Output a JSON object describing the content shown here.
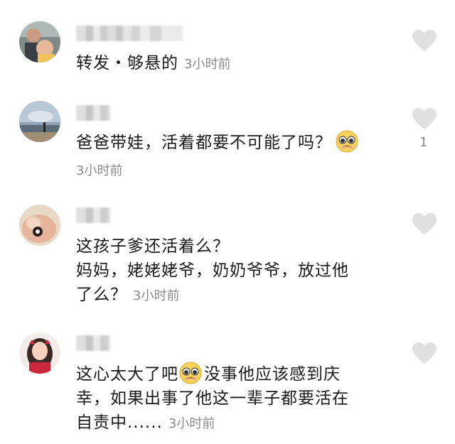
{
  "comments": [
    {
      "text_parts": [
        "转发・够悬的"
      ],
      "time": "3小时前",
      "like_count": ""
    },
    {
      "text_parts": [
        "爸爸带娃，活着都要不可能了吗？"
      ],
      "time": "3小时前",
      "like_count": "1"
    },
    {
      "lines": [
        "这孩子爹还活着么？",
        "妈妈，姥姥姥爷，奶奶爷爷，放过他",
        "了么？"
      ],
      "time": "3小时前",
      "like_count": ""
    },
    {
      "lines_a": "这心太大了吧",
      "lines_b": "没事他应该感到庆",
      "line2": "幸，如果出事了他这一辈子都要活在",
      "line3": "自责中......",
      "time": "3小时前",
      "like_count": ""
    }
  ],
  "icons": {
    "heart": "heart-icon",
    "emoji": "pleading-face-emoji"
  },
  "colors": {
    "heart": "#e0e0e0",
    "time": "#8a8a8a",
    "text": "#1a1a1a"
  }
}
